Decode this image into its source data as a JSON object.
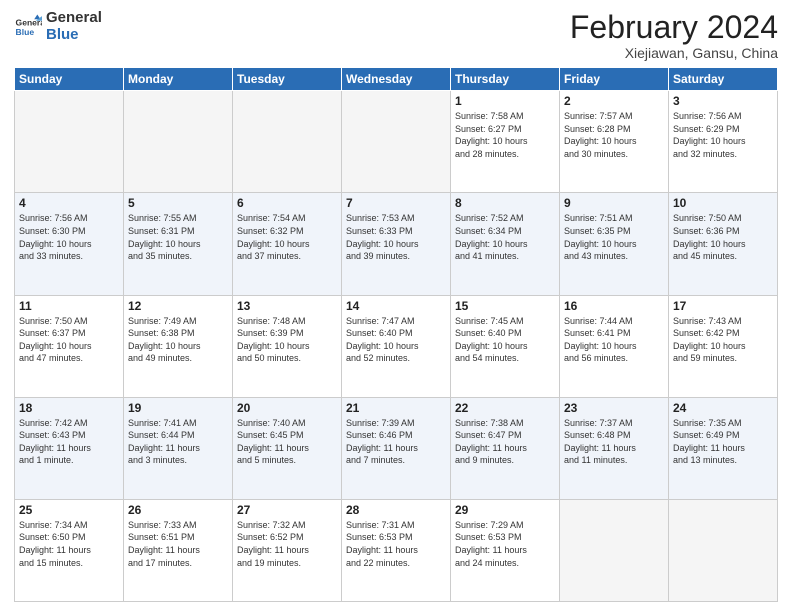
{
  "header": {
    "logo_general": "General",
    "logo_blue": "Blue",
    "month_title": "February 2024",
    "subtitle": "Xiejiawan, Gansu, China"
  },
  "days_of_week": [
    "Sunday",
    "Monday",
    "Tuesday",
    "Wednesday",
    "Thursday",
    "Friday",
    "Saturday"
  ],
  "weeks": [
    [
      {
        "num": "",
        "info": ""
      },
      {
        "num": "",
        "info": ""
      },
      {
        "num": "",
        "info": ""
      },
      {
        "num": "",
        "info": ""
      },
      {
        "num": "1",
        "info": "Sunrise: 7:58 AM\nSunset: 6:27 PM\nDaylight: 10 hours\nand 28 minutes."
      },
      {
        "num": "2",
        "info": "Sunrise: 7:57 AM\nSunset: 6:28 PM\nDaylight: 10 hours\nand 30 minutes."
      },
      {
        "num": "3",
        "info": "Sunrise: 7:56 AM\nSunset: 6:29 PM\nDaylight: 10 hours\nand 32 minutes."
      }
    ],
    [
      {
        "num": "4",
        "info": "Sunrise: 7:56 AM\nSunset: 6:30 PM\nDaylight: 10 hours\nand 33 minutes."
      },
      {
        "num": "5",
        "info": "Sunrise: 7:55 AM\nSunset: 6:31 PM\nDaylight: 10 hours\nand 35 minutes."
      },
      {
        "num": "6",
        "info": "Sunrise: 7:54 AM\nSunset: 6:32 PM\nDaylight: 10 hours\nand 37 minutes."
      },
      {
        "num": "7",
        "info": "Sunrise: 7:53 AM\nSunset: 6:33 PM\nDaylight: 10 hours\nand 39 minutes."
      },
      {
        "num": "8",
        "info": "Sunrise: 7:52 AM\nSunset: 6:34 PM\nDaylight: 10 hours\nand 41 minutes."
      },
      {
        "num": "9",
        "info": "Sunrise: 7:51 AM\nSunset: 6:35 PM\nDaylight: 10 hours\nand 43 minutes."
      },
      {
        "num": "10",
        "info": "Sunrise: 7:50 AM\nSunset: 6:36 PM\nDaylight: 10 hours\nand 45 minutes."
      }
    ],
    [
      {
        "num": "11",
        "info": "Sunrise: 7:50 AM\nSunset: 6:37 PM\nDaylight: 10 hours\nand 47 minutes."
      },
      {
        "num": "12",
        "info": "Sunrise: 7:49 AM\nSunset: 6:38 PM\nDaylight: 10 hours\nand 49 minutes."
      },
      {
        "num": "13",
        "info": "Sunrise: 7:48 AM\nSunset: 6:39 PM\nDaylight: 10 hours\nand 50 minutes."
      },
      {
        "num": "14",
        "info": "Sunrise: 7:47 AM\nSunset: 6:40 PM\nDaylight: 10 hours\nand 52 minutes."
      },
      {
        "num": "15",
        "info": "Sunrise: 7:45 AM\nSunset: 6:40 PM\nDaylight: 10 hours\nand 54 minutes."
      },
      {
        "num": "16",
        "info": "Sunrise: 7:44 AM\nSunset: 6:41 PM\nDaylight: 10 hours\nand 56 minutes."
      },
      {
        "num": "17",
        "info": "Sunrise: 7:43 AM\nSunset: 6:42 PM\nDaylight: 10 hours\nand 59 minutes."
      }
    ],
    [
      {
        "num": "18",
        "info": "Sunrise: 7:42 AM\nSunset: 6:43 PM\nDaylight: 11 hours\nand 1 minute."
      },
      {
        "num": "19",
        "info": "Sunrise: 7:41 AM\nSunset: 6:44 PM\nDaylight: 11 hours\nand 3 minutes."
      },
      {
        "num": "20",
        "info": "Sunrise: 7:40 AM\nSunset: 6:45 PM\nDaylight: 11 hours\nand 5 minutes."
      },
      {
        "num": "21",
        "info": "Sunrise: 7:39 AM\nSunset: 6:46 PM\nDaylight: 11 hours\nand 7 minutes."
      },
      {
        "num": "22",
        "info": "Sunrise: 7:38 AM\nSunset: 6:47 PM\nDaylight: 11 hours\nand 9 minutes."
      },
      {
        "num": "23",
        "info": "Sunrise: 7:37 AM\nSunset: 6:48 PM\nDaylight: 11 hours\nand 11 minutes."
      },
      {
        "num": "24",
        "info": "Sunrise: 7:35 AM\nSunset: 6:49 PM\nDaylight: 11 hours\nand 13 minutes."
      }
    ],
    [
      {
        "num": "25",
        "info": "Sunrise: 7:34 AM\nSunset: 6:50 PM\nDaylight: 11 hours\nand 15 minutes."
      },
      {
        "num": "26",
        "info": "Sunrise: 7:33 AM\nSunset: 6:51 PM\nDaylight: 11 hours\nand 17 minutes."
      },
      {
        "num": "27",
        "info": "Sunrise: 7:32 AM\nSunset: 6:52 PM\nDaylight: 11 hours\nand 19 minutes."
      },
      {
        "num": "28",
        "info": "Sunrise: 7:31 AM\nSunset: 6:53 PM\nDaylight: 11 hours\nand 22 minutes."
      },
      {
        "num": "29",
        "info": "Sunrise: 7:29 AM\nSunset: 6:53 PM\nDaylight: 11 hours\nand 24 minutes."
      },
      {
        "num": "",
        "info": ""
      },
      {
        "num": "",
        "info": ""
      }
    ]
  ]
}
